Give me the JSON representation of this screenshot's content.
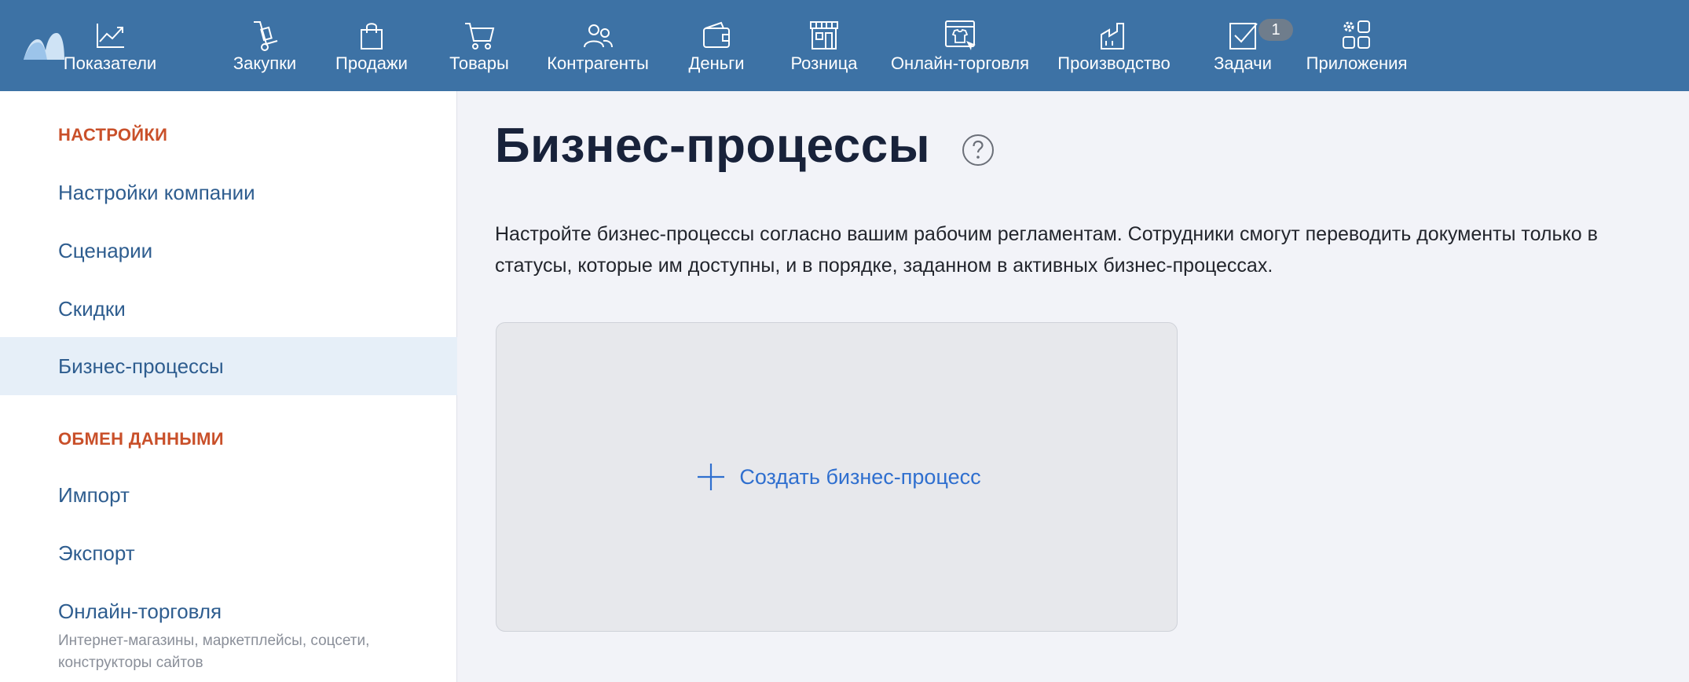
{
  "topbar": {
    "nav": [
      {
        "label": "Показатели",
        "icon": "chart-line-icon"
      },
      {
        "label": "Закупки",
        "icon": "hand-truck-icon"
      },
      {
        "label": "Продажи",
        "icon": "shopping-bag-icon"
      },
      {
        "label": "Товары",
        "icon": "cart-icon"
      },
      {
        "label": "Контрагенты",
        "icon": "people-icon"
      },
      {
        "label": "Деньги",
        "icon": "wallet-icon"
      },
      {
        "label": "Розница",
        "icon": "store-icon"
      },
      {
        "label": "Онлайн-торговля",
        "icon": "online-store-icon"
      },
      {
        "label": "Производство",
        "icon": "factory-icon"
      },
      {
        "label": "Задачи",
        "icon": "checkbox-icon",
        "badge": "1"
      },
      {
        "label": "Приложения",
        "icon": "apps-grid-icon"
      }
    ]
  },
  "sidebar": {
    "section1_title": "НАСТРОЙКИ",
    "section1_items": [
      "Настройки компании",
      "Сценарии",
      "Скидки",
      "Бизнес-процессы"
    ],
    "active_item": "Бизнес-процессы",
    "section2_title": "ОБМЕН ДАННЫМИ",
    "section2_items": [
      "Импорт",
      "Экспорт",
      "Онлайн-торговля"
    ],
    "online_trade_subtitle": "Интернет-магазины, маркетплейсы, соцсети, конструкторы сайтов"
  },
  "main": {
    "title": "Бизнес-процессы",
    "description": "Настройте бизнес-процессы согласно вашим рабочим регламентам. Сотрудники смогут переводить документы только в статусы, которые им доступны, и в порядке, заданном в активных бизнес-процессах.",
    "create_label": "Создать бизнес-процесс"
  },
  "colors": {
    "topbar": "#3d72a5",
    "section_header": "#c9502a",
    "link": "#2e5d8f",
    "accent": "#2f6fcf",
    "active_bg": "#e6eff8"
  }
}
